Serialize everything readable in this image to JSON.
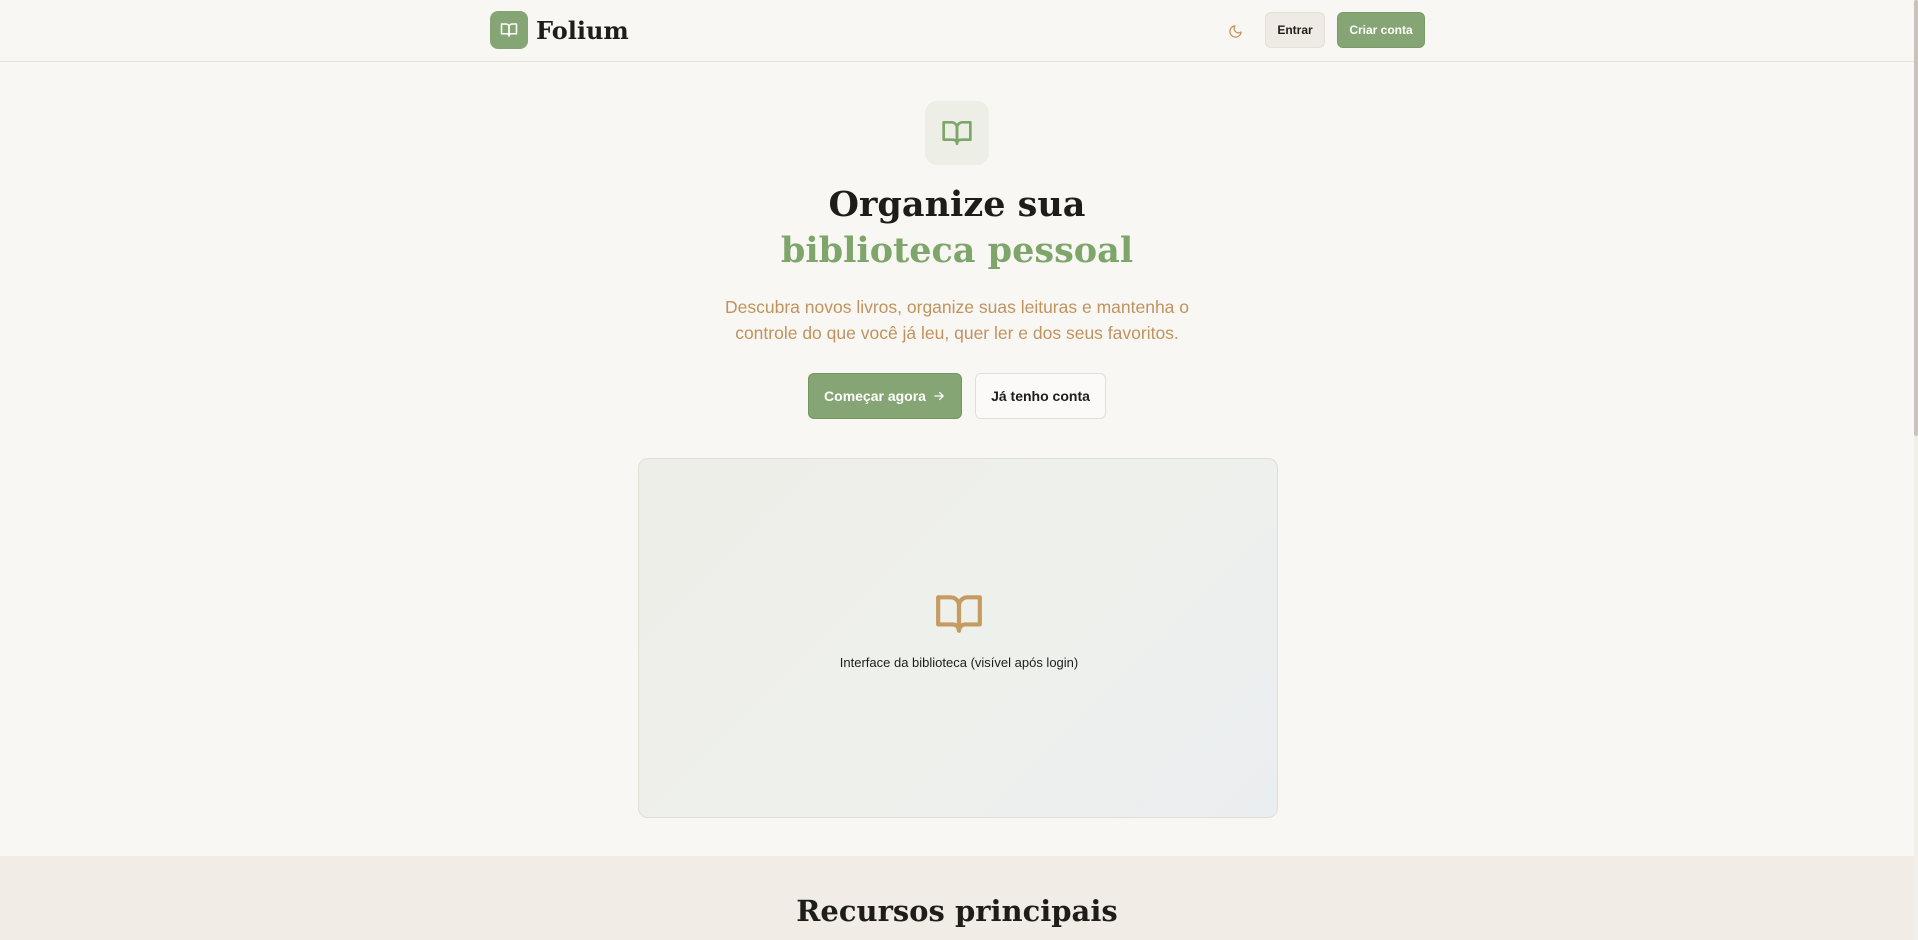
{
  "header": {
    "brand_name": "Folium",
    "logo_icon": "book-open-icon",
    "theme_icon": "moon-icon",
    "login_label": "Entrar",
    "signup_label": "Criar conta"
  },
  "hero": {
    "icon": "book-open-icon",
    "title_line1": "Organize sua",
    "title_line2": "biblioteca pessoal",
    "subtitle": "Descubra novos livros, organize suas leituras e mantenha o controle do que você já leu, quer ler e dos seus favoritos.",
    "cta_primary_label": "Começar agora",
    "cta_primary_icon": "arrow-right-icon",
    "cta_secondary_label": "Já tenho conta"
  },
  "preview": {
    "icon": "book-open-icon",
    "caption": "Interface da biblioteca (visível após login)"
  },
  "features": {
    "title": "Recursos principais"
  },
  "colors": {
    "accent": "#86a574",
    "accent_text": "#7ea56a",
    "subtitle": "#c0935e",
    "background": "#f9f7f3",
    "section_background": "#f1ede6",
    "preview_icon": "#c59b62"
  }
}
